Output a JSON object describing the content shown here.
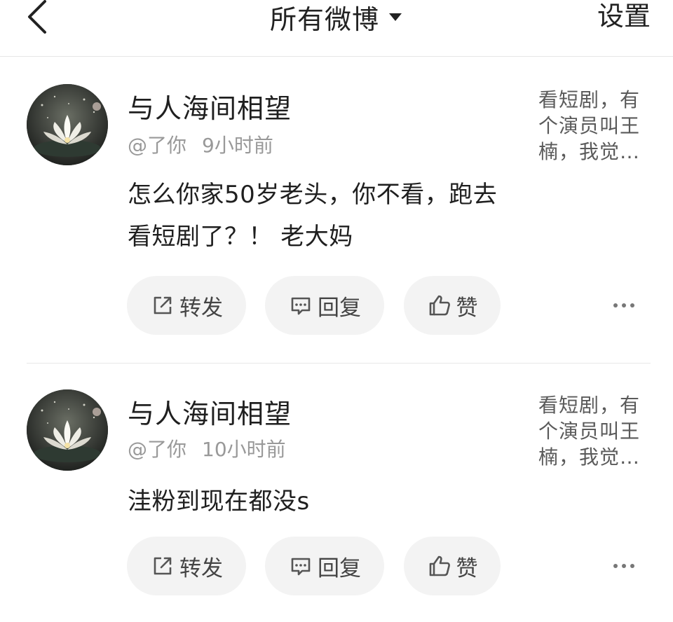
{
  "header": {
    "back_icon": "chevron-left-icon",
    "title": "所有微博",
    "title_icon": "caret-down-icon",
    "settings_label": "设置"
  },
  "posts": [
    {
      "name": "与人海间相望",
      "handle": "@了你",
      "time": "9小时前",
      "content": "怎么你家50岁老头，你不看，跑去看短剧了？！ 老大妈",
      "quote": "看短剧，有个演员叫王楠，我觉…",
      "actions": {
        "repost": "转发",
        "reply": "回复",
        "like": "赞"
      }
    },
    {
      "name": "与人海间相望",
      "handle": "@了你",
      "time": "10小时前",
      "content": "洼粉到现在都没s",
      "quote": "看短剧，有个演员叫王楠，我觉…",
      "actions": {
        "repost": "转发",
        "reply": "回复",
        "like": "赞"
      }
    }
  ]
}
